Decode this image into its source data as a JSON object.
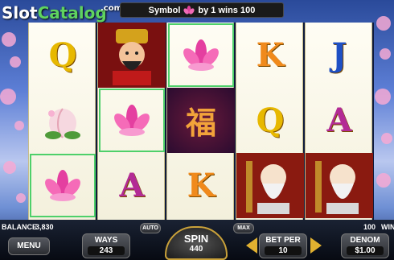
{
  "logo": {
    "text_main": "Slot",
    "text_accent": "Catalog",
    "suffix": ".com"
  },
  "topbar": {
    "prefix": "Symbol",
    "icon": "lotus-flower-icon",
    "message": "by 1 wins 100"
  },
  "reels": [
    [
      "Q",
      "peach",
      "lotus"
    ],
    [
      "god-of-wealth",
      "lotus",
      "A"
    ],
    [
      "lotus",
      "fu-character",
      "K"
    ],
    [
      "K",
      "Q",
      "longevity-sage"
    ],
    [
      "J",
      "A",
      "longevity-sage"
    ]
  ],
  "fu_character": "福",
  "winning_cells": [
    [
      0,
      2
    ],
    [
      1,
      1
    ],
    [
      2,
      0
    ]
  ],
  "footer": {
    "balance_label": "BALANCE",
    "balance_value": "3,830",
    "menu_label": "MENU",
    "ways_label": "WAYS",
    "ways_value": "243",
    "auto_label": "AUTO",
    "spin_label": "SPIN",
    "spin_value": "440",
    "max_label": "MAX",
    "bet_per_label": "BET PER",
    "bet_per_value": "10",
    "win_value": "100",
    "win_label": "WIN",
    "denom_label": "DENOM",
    "denom_value": "$1.00"
  },
  "colors": {
    "win_outline": "#4ed06a",
    "accent_green": "#5fd35f"
  }
}
